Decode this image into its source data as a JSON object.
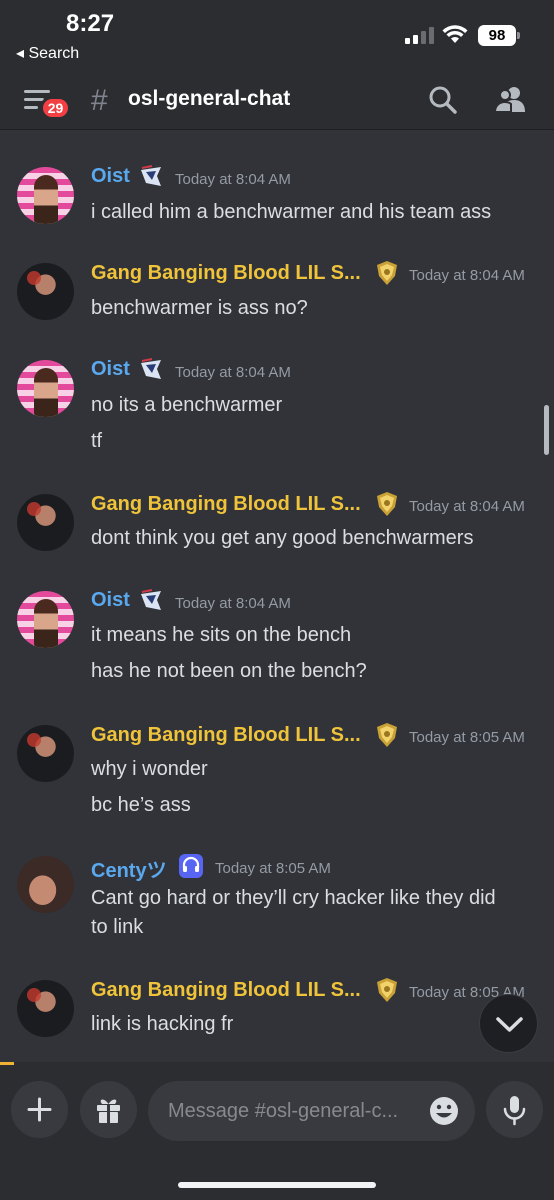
{
  "status_bar": {
    "time": "8:27",
    "back_label": "◂ Search",
    "battery": "98"
  },
  "header": {
    "notification_count": "29",
    "hash": "#",
    "channel_name": "osl-general-chat"
  },
  "colors": {
    "background": "#313338",
    "header": "#2b2d31",
    "username_blue": "#5aa9ef",
    "username_gold": "#f0c43a",
    "timestamp": "#949ba4",
    "badge_red": "#f23f43"
  },
  "messages": [
    {
      "author": "Oist",
      "author_icon": "team-logo-icon",
      "timestamp": "Today at 8:04 AM",
      "lines": [
        "i called him a benchwarmer and his team ass"
      ]
    },
    {
      "author": "Gang Banging Blood LIL S...",
      "author_icon": "gold-trophy-badge-icon",
      "timestamp": "Today at 8:04 AM",
      "lines": [
        "benchwarmer is ass no?"
      ]
    },
    {
      "author": "Oist",
      "author_icon": "team-logo-icon",
      "timestamp": "Today at 8:04 AM",
      "lines": [
        "no its a benchwarmer",
        "tf"
      ]
    },
    {
      "author": "Gang Banging Blood LIL S...",
      "author_icon": "gold-trophy-badge-icon",
      "timestamp": "Today at 8:04 AM",
      "lines": [
        "dont think you get any good benchwarmers"
      ]
    },
    {
      "author": "Oist",
      "author_icon": "team-logo-icon",
      "timestamp": "Today at 8:04 AM",
      "lines": [
        "it means he sits on the bench",
        "has he not been on the bench?"
      ]
    },
    {
      "author": "Gang Banging Blood LIL S...",
      "author_icon": "gold-trophy-badge-icon",
      "timestamp": "Today at 8:05 AM",
      "lines": [
        "why i wonder",
        "bc he’s ass"
      ]
    },
    {
      "author": "Centyツ",
      "author_icon": "headset-badge-icon",
      "timestamp": "Today at 8:05 AM",
      "lines": [
        "Cant go hard or they’ll cry hacker like they did",
        "to link"
      ]
    },
    {
      "author": "Gang Banging Blood LIL S...",
      "author_icon": "gold-trophy-badge-icon",
      "timestamp": "Today at 8:05 AM",
      "lines": [
        "link is hacking fr"
      ]
    }
  ],
  "composer": {
    "placeholder": "Message #osl-general-c..."
  }
}
